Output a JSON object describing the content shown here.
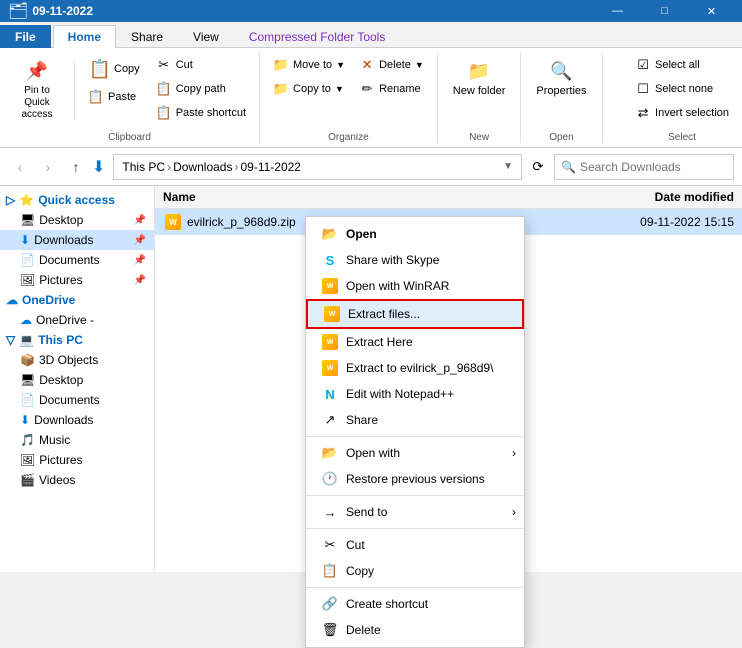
{
  "titleBar": {
    "text": "09-11-2022",
    "controls": [
      "—",
      "□",
      "✕"
    ]
  },
  "ribbonTabs": [
    {
      "label": "File",
      "class": "file"
    },
    {
      "label": "Home",
      "class": "active"
    },
    {
      "label": "Share",
      "class": ""
    },
    {
      "label": "View",
      "class": ""
    },
    {
      "label": "Compressed Folder Tools",
      "class": "compressed"
    }
  ],
  "ribbon": {
    "clipboard": {
      "label": "Clipboard",
      "pinToQuickAccess": "Pin to Quick access",
      "cut": "Cut",
      "copyPath": "Copy path",
      "pasteShortcut": "Paste shortcut",
      "copy": "Copy",
      "paste": "Paste"
    },
    "organize": {
      "label": "Organize",
      "moveTo": "Move to",
      "delete": "Delete",
      "copyTo": "Copy to",
      "rename": "Rename"
    },
    "new": {
      "label": "New",
      "newFolder": "New folder"
    },
    "open": {
      "label": "Open",
      "properties": "Properties"
    },
    "select": {
      "label": "Select",
      "selectAll": "Select all",
      "selectNone": "Select none",
      "invertSelection": "Invert selection"
    }
  },
  "addressBar": {
    "back": "‹",
    "forward": "›",
    "up": "↑",
    "pathParts": [
      "This PC",
      "Downloads",
      "09-11-2022"
    ],
    "refresh": "⟳",
    "searchPlaceholder": "Search Downloads"
  },
  "sidebar": {
    "sections": [
      {
        "label": "Quick access",
        "type": "header",
        "icon": "⭐"
      },
      {
        "label": "Desktop",
        "icon": "🖥",
        "sub": true,
        "pin": true
      },
      {
        "label": "Downloads",
        "icon": "⬇",
        "sub": true,
        "pin": true,
        "active": true
      },
      {
        "label": "Documents",
        "icon": "📄",
        "sub": true,
        "pin": true
      },
      {
        "label": "Pictures",
        "icon": "🖼",
        "sub": true,
        "pin": true
      },
      {
        "label": "OneDrive",
        "icon": "☁",
        "type": "header"
      },
      {
        "label": "OneDrive -",
        "icon": "☁",
        "sub": true
      },
      {
        "label": "This PC",
        "icon": "💻",
        "type": "header"
      },
      {
        "label": "3D Objects",
        "icon": "📦",
        "sub": true
      },
      {
        "label": "Desktop",
        "icon": "🖥",
        "sub": true
      },
      {
        "label": "Documents",
        "icon": "📄",
        "sub": true
      },
      {
        "label": "Downloads",
        "icon": "⬇",
        "sub": true
      },
      {
        "label": "Music",
        "icon": "♪",
        "sub": true
      },
      {
        "label": "Pictures",
        "icon": "🖼",
        "sub": true
      },
      {
        "label": "Videos",
        "icon": "🎬",
        "sub": true
      }
    ]
  },
  "fileList": {
    "columns": [
      {
        "label": "Name"
      },
      {
        "label": "Date modified"
      }
    ],
    "files": [
      {
        "name": "evilrick_p_968d9.zip",
        "date": "09-11-2022 15:15",
        "selected": true
      }
    ]
  },
  "contextMenu": {
    "items": [
      {
        "label": "Open",
        "icon": "📂",
        "bold": true
      },
      {
        "label": "Share with Skype",
        "icon": "S",
        "iconClass": "icon-skype"
      },
      {
        "label": "Open with WinRAR",
        "icon": "W",
        "iconClass": "icon-winrar"
      },
      {
        "label": "Extract files...",
        "icon": "E",
        "highlighted": true
      },
      {
        "label": "Extract Here",
        "icon": "E"
      },
      {
        "label": "Extract to evilrick_p_968d9\\",
        "icon": "E"
      },
      {
        "label": "Edit with Notepad++",
        "icon": "N",
        "iconClass": "icon-notepad"
      },
      {
        "label": "Share",
        "icon": "↗",
        "sep_after": true
      },
      {
        "label": "Open with",
        "icon": "📂",
        "hasSub": true
      },
      {
        "label": "Restore previous versions",
        "icon": "🕐",
        "sep_after": true
      },
      {
        "label": "Send to",
        "icon": "→",
        "hasSub": true,
        "sep_after": true
      },
      {
        "label": "Cut",
        "icon": "✂"
      },
      {
        "label": "Copy",
        "icon": "📋",
        "sep_after": true
      },
      {
        "label": "Create shortcut",
        "icon": "🔗"
      },
      {
        "label": "Delete",
        "icon": "🗑"
      }
    ]
  }
}
